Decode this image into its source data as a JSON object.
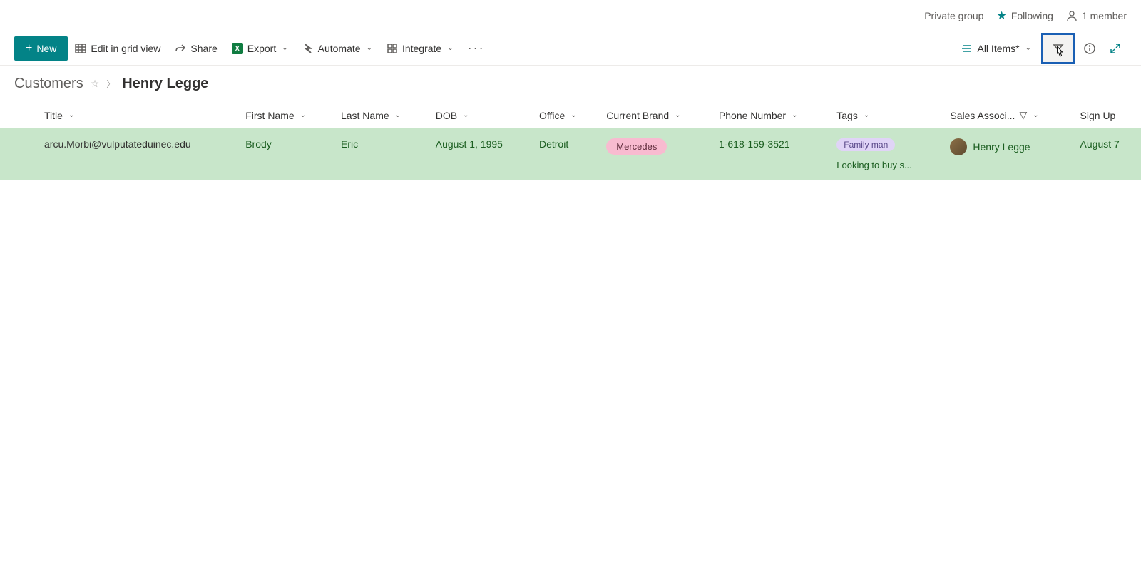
{
  "header": {
    "group_type": "Private group",
    "following_label": "Following",
    "members_label": "1 member"
  },
  "toolbar": {
    "new_label": "New",
    "edit_grid_label": "Edit in grid view",
    "share_label": "Share",
    "export_label": "Export",
    "automate_label": "Automate",
    "integrate_label": "Integrate",
    "view_label": "All Items*"
  },
  "breadcrumb": {
    "root": "Customers",
    "current": "Henry Legge"
  },
  "columns": {
    "title": "Title",
    "first_name": "First Name",
    "last_name": "Last Name",
    "dob": "DOB",
    "office": "Office",
    "current_brand": "Current Brand",
    "phone_number": "Phone Number",
    "tags": "Tags",
    "sales_associate": "Sales Associ...",
    "sign_up": "Sign Up"
  },
  "rows": [
    {
      "title": "arcu.Morbi@vulputateduinec.edu",
      "first_name": "Brody",
      "last_name": "Eric",
      "dob": "August 1, 1995",
      "office": "Detroit",
      "current_brand": "Mercedes",
      "phone_number": "1-618-159-3521",
      "tags": {
        "primary": "Family man",
        "secondary": "Looking to buy s..."
      },
      "sales_associate": "Henry Legge",
      "sign_up": "August 7"
    }
  ]
}
